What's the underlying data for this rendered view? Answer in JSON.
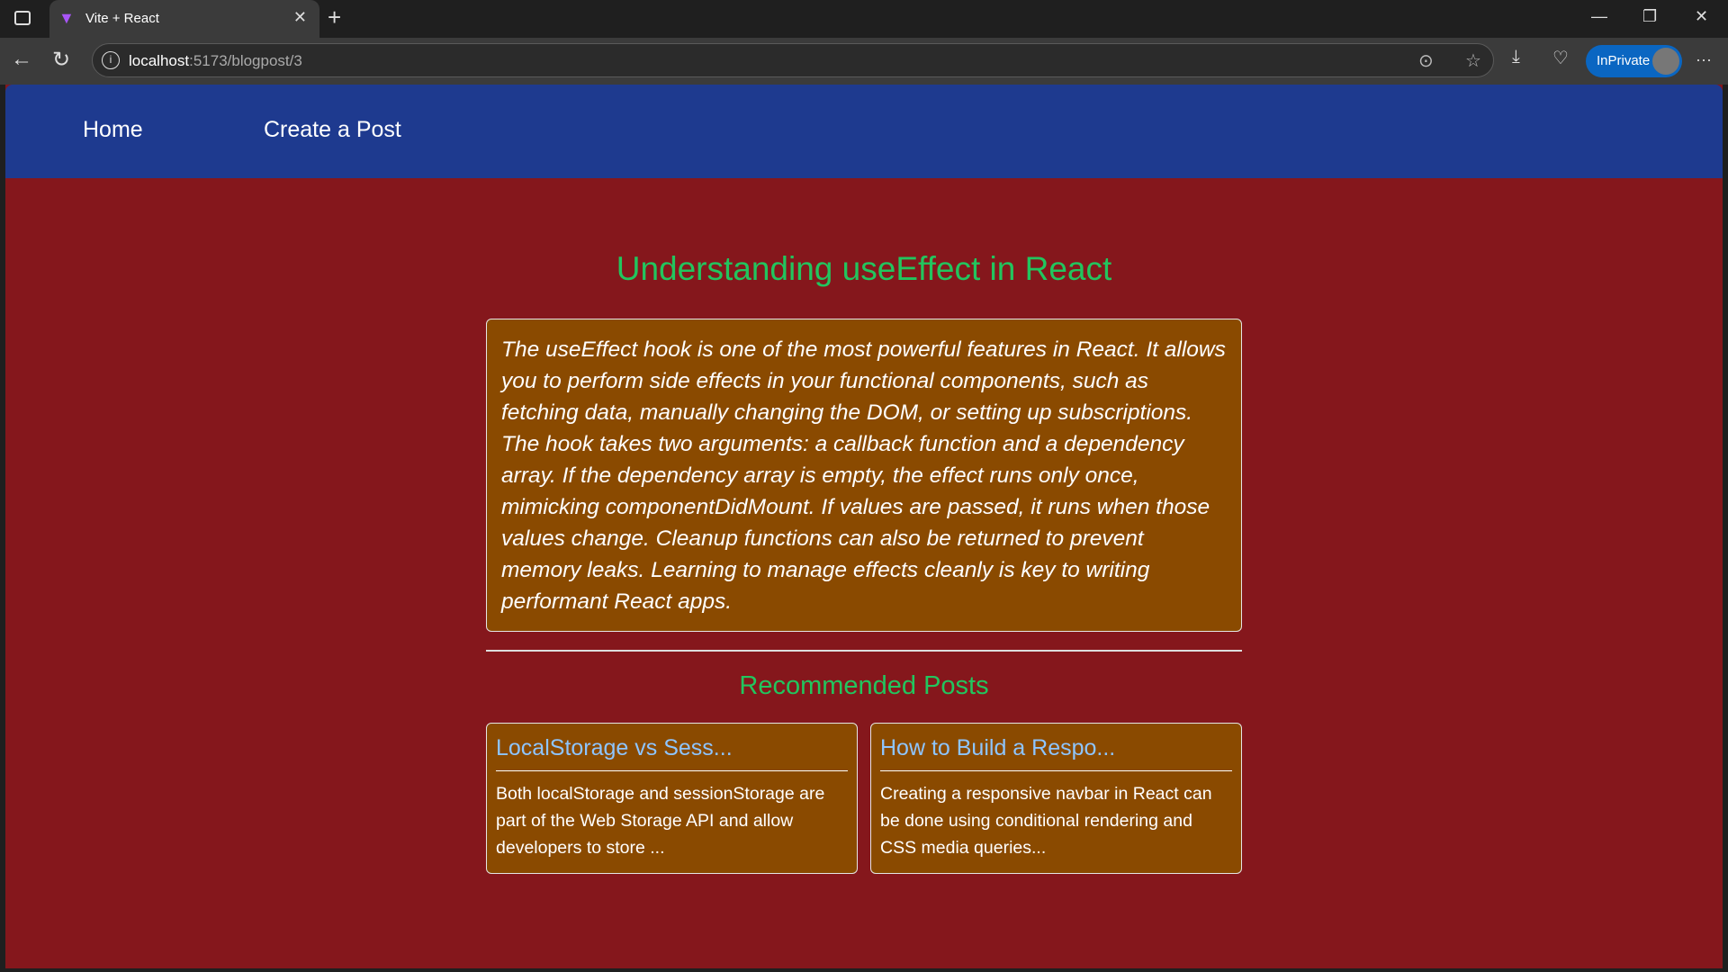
{
  "browser": {
    "tab_title": "Vite + React",
    "url_host": "localhost",
    "url_path": ":5173/blogpost/3",
    "inprivate_label": "InPrivate"
  },
  "nav": {
    "items": [
      {
        "label": "Home"
      },
      {
        "label": "Create a Post"
      }
    ]
  },
  "post": {
    "title": "Understanding useEffect in React",
    "body": "The useEffect hook is one of the most powerful features in React. It allows you to perform side effects in your functional components, such as fetching data, manually changing the DOM, or setting up subscriptions. The hook takes two arguments: a callback function and a dependency array. If the dependency array is empty, the effect runs only once, mimicking componentDidMount. If values are passed, it runs when those values change. Cleanup functions can also be returned to prevent memory leaks. Learning to manage effects cleanly is key to writing performant React apps."
  },
  "recommended": {
    "heading": "Recommended Posts",
    "cards": [
      {
        "title": "LocalStorage vs Sess...",
        "excerpt": "Both localStorage and sessionStorage are part of the Web Storage API and allow developers to store ..."
      },
      {
        "title": "How to Build a Respo...",
        "excerpt": "Creating a responsive navbar in React can be done using conditional rendering and CSS media queries..."
      }
    ]
  },
  "colors": {
    "navbar": "#1e3a8f",
    "page": "#85171c",
    "card": "#8a4a00",
    "heading": "#22c55e",
    "link": "#8ec5ff"
  }
}
